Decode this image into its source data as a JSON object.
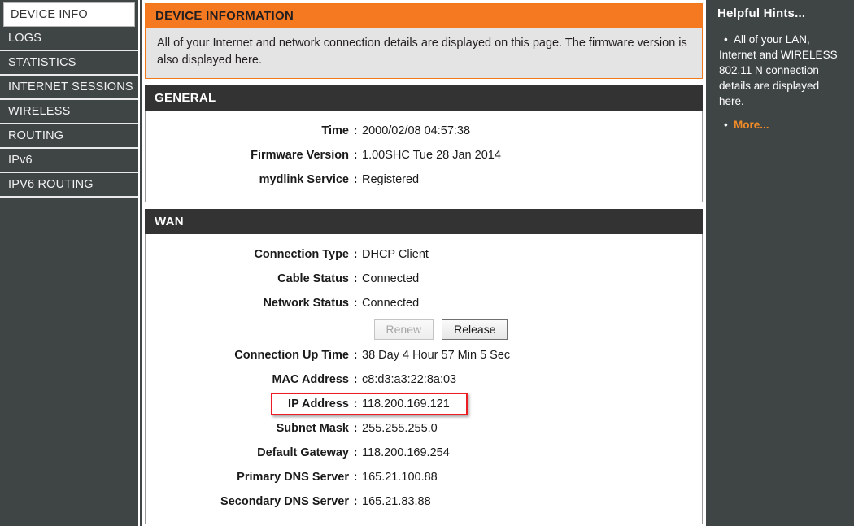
{
  "sidebar": {
    "items": [
      {
        "label": "DEVICE INFO",
        "active": true
      },
      {
        "label": "LOGS",
        "active": false
      },
      {
        "label": "STATISTICS",
        "active": false
      },
      {
        "label": "INTERNET SESSIONS",
        "active": false
      },
      {
        "label": "WIRELESS",
        "active": false
      },
      {
        "label": "ROUTING",
        "active": false
      },
      {
        "label": "IPv6",
        "active": false
      },
      {
        "label": "IPV6 ROUTING",
        "active": false
      }
    ]
  },
  "info": {
    "title": "DEVICE INFORMATION",
    "description": "All of your Internet and network connection details are displayed on this page. The firmware version is also displayed here."
  },
  "general": {
    "title": "GENERAL",
    "rows": [
      {
        "label": "Time",
        "value": "2000/02/08 04:57:38"
      },
      {
        "label": "Firmware Version",
        "value": "1.00SHC Tue 28 Jan 2014"
      },
      {
        "label": "mydlink Service",
        "value": "Registered"
      }
    ]
  },
  "wan": {
    "title": "WAN",
    "rows_top": [
      {
        "label": "Connection Type",
        "value": "DHCP Client"
      },
      {
        "label": "Cable Status",
        "value": "Connected"
      },
      {
        "label": "Network Status",
        "value": "Connected"
      }
    ],
    "buttons": {
      "renew": "Renew",
      "release": "Release"
    },
    "rows_bottom": [
      {
        "label": "Connection Up Time",
        "value": "38 Day 4 Hour 57 Min 5 Sec"
      },
      {
        "label": "MAC Address",
        "value": "c8:d3:a3:22:8a:03"
      },
      {
        "label": "IP Address",
        "value": "118.200.169.121"
      },
      {
        "label": "Subnet Mask",
        "value": "255.255.255.0"
      },
      {
        "label": "Default Gateway",
        "value": "118.200.169.254"
      },
      {
        "label": "Primary DNS Server",
        "value": "165.21.100.88"
      },
      {
        "label": "Secondary DNS Server",
        "value": "165.21.83.88"
      }
    ]
  },
  "hints": {
    "title": "Helpful Hints...",
    "items": [
      "All of your LAN, Internet and WIRELESS 802.11 N connection details are displayed here."
    ],
    "more_label": "More..."
  },
  "annotation": {
    "highlight_row_label": "IP Address",
    "color": "#ee1c25"
  },
  "colors": {
    "accent_orange": "#f57920",
    "panel_dark": "#333333",
    "sidebar_dark": "#3f4444",
    "description_bg": "#e4e4e4",
    "link_orange": "#f08c28"
  },
  "colon": ":",
  "bullet": "•"
}
